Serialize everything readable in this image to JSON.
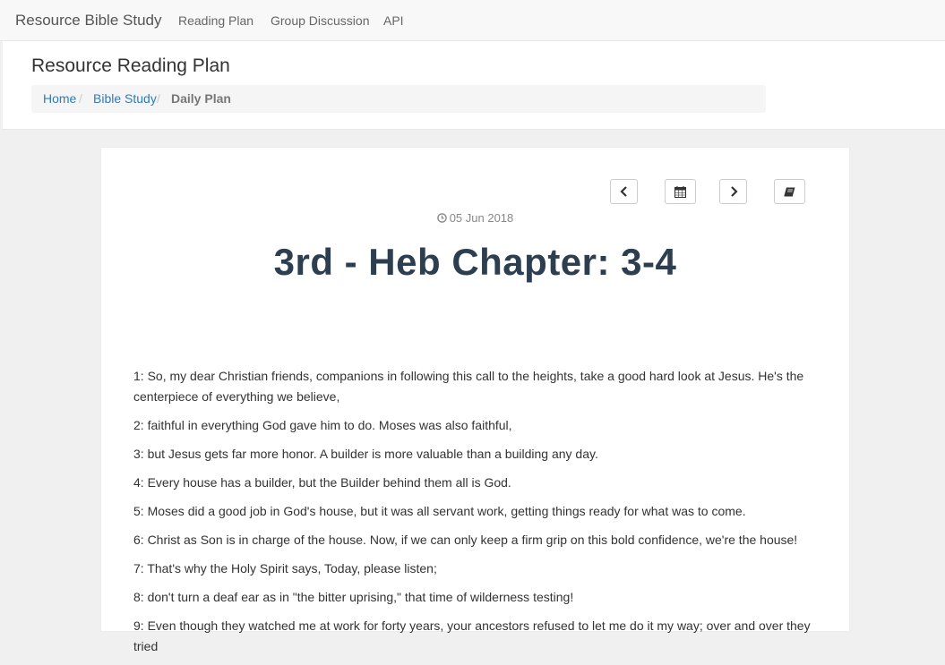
{
  "navbar": {
    "brand": "Resource Bible Study",
    "links": [
      "Reading Plan",
      "Group Discussion",
      "API"
    ]
  },
  "header": {
    "title": "Resource Reading Plan",
    "breadcrumb": [
      "Home",
      "Bible Study",
      "Daily Plan"
    ]
  },
  "reading": {
    "controls": [
      "chevron-left-icon",
      "calendar-icon",
      "chevron-right-icon",
      "book-icon"
    ],
    "date": "05 Jun 2018",
    "title": "3rd - Heb Chapter: 3-4",
    "verses": [
      "1: So, my dear Christian friends, companions in following this call to the heights, take a good hard look at Jesus. He's the centerpiece of everything we believe,",
      "2: faithful in everything God gave him to do. Moses was also faithful,",
      "3: but Jesus gets far more honor. A builder is more valuable than a building any day.",
      "4: Every house has a builder, but the Builder behind them all is God.",
      "5: Moses did a good job in God's house, but it was all servant work, getting things ready for what was to come.",
      "6: Christ as Son is in charge of the house. Now, if we can only keep a firm grip on this bold confidence, we're the house!",
      "7: That's why the Holy Spirit says, Today, please listen;",
      "8: don't turn a deaf ear as in \"the bitter uprising,\" that time of wilderness testing!",
      "9: Even though they watched me at work for forty years, your ancestors refused to let me do it my way; over and over they tried"
    ]
  },
  "colors": {
    "link": "#337ab7",
    "title": "#2c3e50",
    "navbar_bg": "#f8f8f8",
    "page_bg": "#f0f0f0"
  }
}
